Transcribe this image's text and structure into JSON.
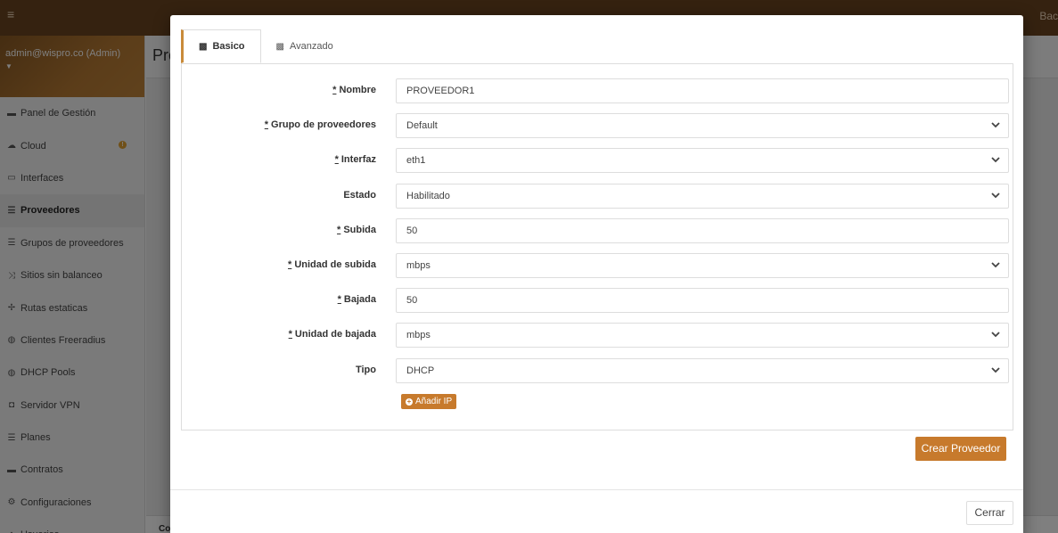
{
  "topbar": {
    "menu_icon": "menu-icon",
    "right_text": "Bac"
  },
  "sidebar": {
    "user": "admin@wispro.co (Admin)",
    "items": [
      {
        "label": "Panel de Gestión",
        "icon": "chart-icon"
      },
      {
        "label": "Cloud",
        "icon": "cloud-icon",
        "badge": "!"
      },
      {
        "label": "Interfaces",
        "icon": "interfaces-icon"
      },
      {
        "label": "Proveedores",
        "icon": "list-icon",
        "active": true
      },
      {
        "label": "Grupos de proveedores",
        "icon": "list-icon"
      },
      {
        "label": "Sitios sin balanceo",
        "icon": "shuffle-icon"
      },
      {
        "label": "Rutas estaticas",
        "icon": "arrows-icon"
      },
      {
        "label": "Clientes Freeradius",
        "icon": "globe-icon"
      },
      {
        "label": "DHCP Pools",
        "icon": "globe-icon"
      },
      {
        "label": "Servidor VPN",
        "icon": "shield-icon"
      },
      {
        "label": "Planes",
        "icon": "list-icon"
      },
      {
        "label": "Contratos",
        "icon": "chart-icon"
      },
      {
        "label": "Configuraciones",
        "icon": "gears-icon"
      },
      {
        "label": "Usuarios",
        "icon": "users-icon"
      }
    ]
  },
  "header": {
    "title": "Pro"
  },
  "footer": {
    "text": "Co"
  },
  "modal": {
    "tabs": [
      {
        "label": "Basico",
        "icon": "briefcase-icon",
        "active": true
      },
      {
        "label": "Avanzado",
        "icon": "briefcase-icon",
        "active": false
      }
    ],
    "fields": [
      {
        "label": "Nombre",
        "required": true,
        "type": "text",
        "value": "PROVEEDOR1"
      },
      {
        "label": "Grupo de proveedores",
        "required": true,
        "type": "select",
        "value": "Default"
      },
      {
        "label": "Interfaz",
        "required": true,
        "type": "select",
        "value": "eth1"
      },
      {
        "label": "Estado",
        "required": false,
        "type": "select",
        "value": "Habilitado"
      },
      {
        "label": "Subida",
        "required": true,
        "type": "text",
        "value": "50"
      },
      {
        "label": "Unidad de subida",
        "required": true,
        "type": "select",
        "value": "mbps"
      },
      {
        "label": "Bajada",
        "required": true,
        "type": "text",
        "value": "50"
      },
      {
        "label": "Unidad de bajada",
        "required": true,
        "type": "select",
        "value": "mbps"
      },
      {
        "label": "Tipo",
        "required": false,
        "type": "select",
        "value": "DHCP"
      }
    ],
    "add_ip_label": "Añadir IP",
    "create_label": "Crear Proveedor",
    "close_label": "Cerrar",
    "required_marker": "*",
    "chevron_glyph": "❯"
  },
  "colors": {
    "accent": "#c77a2c",
    "topbar": "#6b4420"
  }
}
